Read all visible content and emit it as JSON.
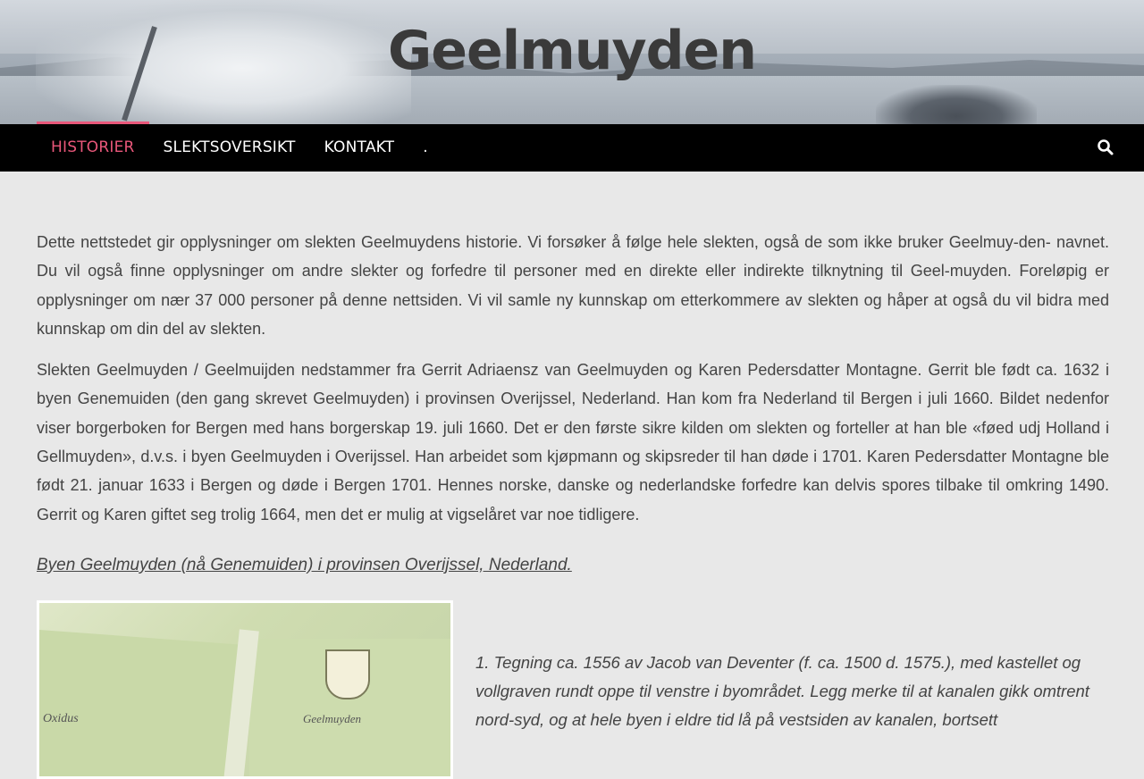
{
  "site": {
    "title": "Geelmuyden"
  },
  "nav": {
    "items": [
      {
        "label": "HISTORIER",
        "active": true
      },
      {
        "label": "SLEKTSOVERSIKT",
        "active": false
      },
      {
        "label": "KONTAKT",
        "active": false
      },
      {
        "label": ".",
        "active": false
      }
    ],
    "search_icon": "search-icon",
    "accent_color": "#e9577a"
  },
  "content": {
    "paragraphs": [
      "Dette nettstedet gir opplysninger om slekten Geelmuydens historie.   Vi forsøker å følge hele slekten, også de som ikke bruker Geelmuy-den- navnet.  Du vil også finne opplysninger om andre slekter og forfedre til personer med en direkte eller indirekte tilknytning til Geel-muyden.  Foreløpig er opplysninger om nær 37 000 personer på denne nettsiden.  Vi vil samle ny kunnskap om etterkommere av slekten og håper at også du vil bidra med kunnskap om din del av slekten.",
      "Slekten Geelmuyden / Geelmuijden nedstammer fra Gerrit Adriaensz van Geelmuyden og Karen Pedersdatter Montagne.   Gerrit ble født ca. 1632 i byen Genemuiden (den gang skrevet Geelmuyden) i provinsen Overijssel, Nederland.  Han kom fra Nederland til Bergen i juli 1660.  Bildet nedenfor viser borgerboken for Bergen med hans borgerskap 19. juli 1660.  Det er den første sikre kilden om slekten og forteller at han ble «føed udj Holland i Gellmuyden», d.v.s. i byen Geelmuyden i Overijssel.  Han arbeidet som kjøpmann og skipsreder til han døde i 1701. Karen Pedersdatter Montagne ble født 21. januar 1633 i Bergen og døde i Bergen 1701.  Hennes norske, danske og nederlandske forfedre kan delvis spores tilbake til omkring 1490.   Gerrit og Karen giftet seg trolig 1664, men det er mulig at vigselåret var noe tidligere."
    ],
    "section_link": "Byen Geelmuyden (nå Genemuiden) i provinsen Overijssel, Nederland.",
    "figure": {
      "map_text_left": "Oxidus",
      "map_text_right": "Geelmuyden",
      "caption": "1.  Tegning ca. 1556 av Jacob van Deventer (f. ca. 1500 d. 1575.), med kastellet og vollgraven rundt oppe til venstre i byområdet.  Legg merke til at kanalen gikk omtrent nord-syd, og at hele byen i eldre tid lå på vestsiden av kanalen, bortsett"
    }
  }
}
